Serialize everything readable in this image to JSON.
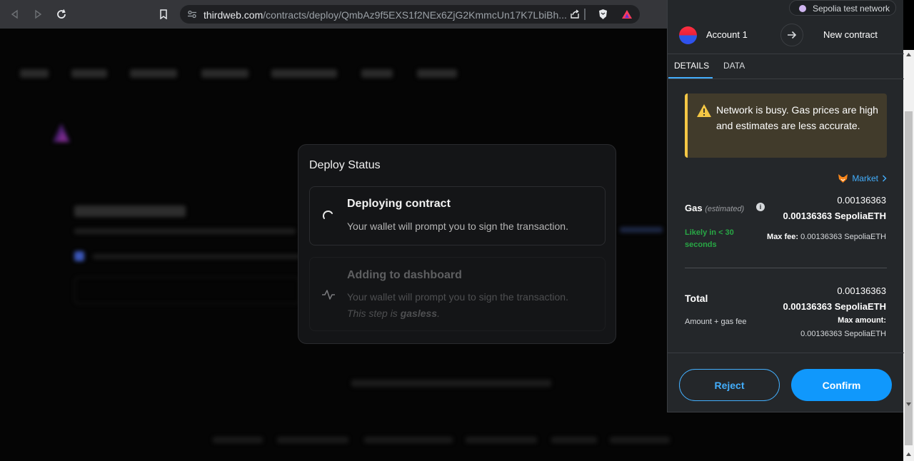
{
  "browser": {
    "url_host": "thirdweb.com",
    "url_path": "/contracts/deploy/QmbAz9f5EXS1f2NEx6ZjG2KmmcUn17K7LbiBh..."
  },
  "deploy_modal": {
    "title": "Deploy Status",
    "steps": [
      {
        "title": "Deploying contract",
        "description": "Your wallet will prompt you to sign the transaction."
      },
      {
        "title": "Adding to dashboard",
        "description": "Your wallet will prompt you to sign the transaction.",
        "note_prefix": "This step is ",
        "note_bold": "gasless",
        "note_suffix": "."
      }
    ]
  },
  "wallet": {
    "network": "Sepolia test network",
    "account_name": "Account 1",
    "destination": "New contract",
    "tabs": [
      "DETAILS",
      "DATA"
    ],
    "warning": "Network is busy. Gas prices are high and estimates are less accurate.",
    "market_label": "Market",
    "gas": {
      "label": "Gas",
      "estimated_label": "(estimated)",
      "fiat_value": "0.00136363",
      "eth_value": "0.00136363 SepoliaETH",
      "likely": "Likely in < 30 seconds",
      "max_fee_label": "Max fee:",
      "max_fee_value": "0.00136363 SepoliaETH"
    },
    "total": {
      "label": "Total",
      "fiat_value": "0.00136363",
      "eth_value": "0.00136363 SepoliaETH",
      "amount_gas_label": "Amount + gas fee",
      "max_amount_label": "Max amount:",
      "max_amount_value": "0.00136363 SepoliaETH"
    },
    "buttons": {
      "reject": "Reject",
      "confirm": "Confirm"
    }
  },
  "colors": {
    "accent_blue": "#43aefc",
    "confirm_blue": "#1098fc",
    "warning_yellow": "#f4c745",
    "likely_green": "#28a745"
  }
}
